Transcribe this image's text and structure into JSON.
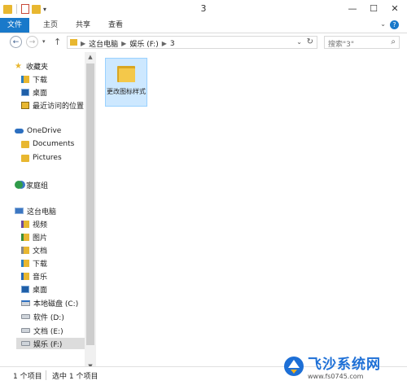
{
  "window": {
    "title": "3",
    "minimize": "—",
    "maximize": "☐",
    "close": "✕"
  },
  "quick_access": {
    "dropdown": "▾"
  },
  "ribbon": {
    "tabs": [
      {
        "label": "文件"
      },
      {
        "label": "主页"
      },
      {
        "label": "共享"
      },
      {
        "label": "查看"
      }
    ],
    "expand": "⌄",
    "help": "?"
  },
  "address": {
    "back": "←",
    "forward": "→",
    "recent": "▾",
    "up": "↑",
    "crumbs": [
      "这台电脑",
      "娱乐 (F:)",
      "3"
    ],
    "separator": "▶",
    "dropdown": "⌄",
    "refresh": "↻"
  },
  "search": {
    "placeholder": "搜索\"3\"",
    "icon": "⌕"
  },
  "nav": {
    "favorites": {
      "label": "收藏夹",
      "items": [
        "下载",
        "桌面",
        "最近访问的位置"
      ]
    },
    "onedrive": {
      "label": "OneDrive",
      "items": [
        "Documents",
        "Pictures"
      ]
    },
    "homegroup": {
      "label": "家庭组"
    },
    "thispc": {
      "label": "这台电脑",
      "items": [
        "视频",
        "图片",
        "文档",
        "下载",
        "音乐",
        "桌面"
      ],
      "drives": [
        "本地磁盘 (C:)",
        "软件 (D:)",
        "文档 (E:)",
        "娱乐 (F:)"
      ]
    }
  },
  "scrollbar": {
    "up": "▲",
    "down": "▼"
  },
  "content": {
    "items": [
      {
        "name": "更改图标样式"
      }
    ]
  },
  "status": {
    "count": "1 个项目",
    "selected": "选中 1 个项目"
  },
  "watermark": {
    "brand": "飞沙系统网",
    "url": "www.fs0745.com"
  },
  "colors": {
    "accent": "#1979ca",
    "folder": "#e8b730",
    "selection": "#cde8ff"
  }
}
